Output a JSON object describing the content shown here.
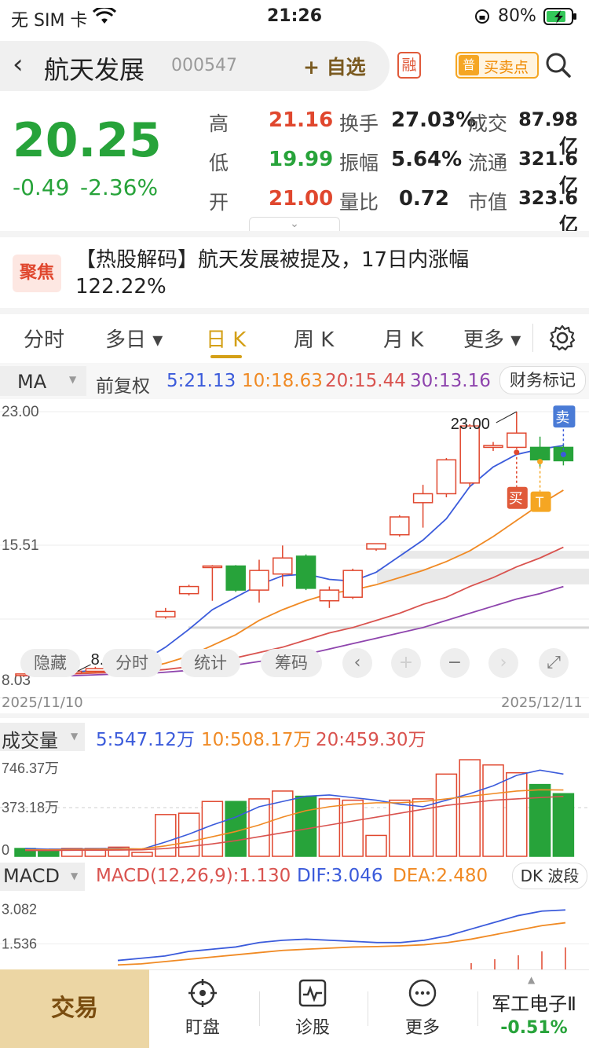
{
  "status": {
    "carrier": "无 SIM 卡",
    "time": "21:26",
    "battery": "80%"
  },
  "header": {
    "stock_name": "航天发展",
    "stock_code": "000547",
    "watch_label": "+ 自选",
    "margin_label": "融",
    "bs_points_badge": "普",
    "bs_points_label": "买卖点"
  },
  "quote": {
    "price": "20.25",
    "change": "-0.49",
    "change_pct": "-2.36%",
    "rows": [
      {
        "l1": "高",
        "v1": "21.16",
        "l2": "换手",
        "v2": "27.03%",
        "l3": "成交",
        "v3": "87.98亿"
      },
      {
        "l1": "低",
        "v1": "19.99",
        "l2": "振幅",
        "v2": "5.64%",
        "l3": "流通",
        "v3": "321.6亿"
      },
      {
        "l1": "开",
        "v1": "21.00",
        "l2": "量比",
        "v2": "0.72",
        "l3": "市值",
        "v3": "323.6亿"
      }
    ],
    "colors": {
      "up": "#e0472e",
      "down": "#27a33a",
      "neutral": "#222222"
    }
  },
  "news": {
    "badge": "聚焦",
    "text": "【热股解码】航天发展被提及，17日内涨幅122.22%"
  },
  "tabs": [
    {
      "label": "分时"
    },
    {
      "label": "多日 ▾"
    },
    {
      "label": "日 K"
    },
    {
      "label": "周 K"
    },
    {
      "label": "月 K"
    },
    {
      "label": "更多 ▾"
    }
  ],
  "active_tab": "日 K",
  "ma_bar": {
    "selector": "MA",
    "adjust": "前复权",
    "ma5": "5:21.13",
    "ma10": "10:18.63",
    "ma20": "20:15.44",
    "ma30": "30:13.16",
    "finance_btn": "财务标记"
  },
  "chart_controls": [
    "隐藏",
    "分时",
    "统计",
    "筹码",
    "‹",
    "+",
    "−",
    "›",
    "⤢"
  ],
  "chart_data": [
    {
      "type": "candlestick",
      "title": "",
      "x_start": "2025/11/10",
      "x_end": "2025/12/11",
      "y_ticks": [
        "23.00",
        "15.51",
        "8.03"
      ],
      "ylim": [
        8.03,
        23.0
      ],
      "high_label": "23.00",
      "low_label": "8.26",
      "candles": [
        {
          "o": 8.26,
          "c": 8.3,
          "h": 8.35,
          "l": 8.26
        },
        {
          "o": 8.3,
          "c": 8.35,
          "h": 8.4,
          "l": 8.28
        },
        {
          "o": 8.35,
          "c": 8.45,
          "h": 8.5,
          "l": 8.3
        },
        {
          "o": 8.45,
          "c": 8.6,
          "h": 8.7,
          "l": 8.4
        },
        {
          "o": 8.6,
          "c": 9.2,
          "h": 9.3,
          "l": 8.55
        },
        {
          "o": 9.3,
          "c": 9.45,
          "h": 9.5,
          "l": 9.25
        },
        {
          "o": 11.5,
          "c": 11.8,
          "h": 12.0,
          "l": 11.4
        },
        {
          "o": 12.8,
          "c": 13.2,
          "h": 13.3,
          "l": 12.7
        },
        {
          "o": 14.3,
          "c": 14.35,
          "h": 14.4,
          "l": 12.4
        },
        {
          "o": 14.35,
          "c": 13.0,
          "h": 14.4,
          "l": 12.9
        },
        {
          "o": 13.0,
          "c": 14.1,
          "h": 14.7,
          "l": 12.3
        },
        {
          "o": 13.9,
          "c": 14.8,
          "h": 15.5,
          "l": 13.2
        },
        {
          "o": 14.9,
          "c": 13.1,
          "h": 15.0,
          "l": 13.0
        },
        {
          "o": 12.4,
          "c": 13.0,
          "h": 13.2,
          "l": 12.0
        },
        {
          "o": 12.6,
          "c": 14.1,
          "h": 14.2,
          "l": 12.5
        },
        {
          "o": 15.3,
          "c": 15.6,
          "h": 15.6,
          "l": 15.2
        },
        {
          "o": 16.1,
          "c": 17.1,
          "h": 17.2,
          "l": 16.0
        },
        {
          "o": 17.9,
          "c": 18.4,
          "h": 18.9,
          "l": 16.5
        },
        {
          "o": 18.4,
          "c": 20.3,
          "h": 20.4,
          "l": 18.2
        },
        {
          "o": 19.0,
          "c": 22.2,
          "h": 22.3,
          "l": 18.8
        },
        {
          "o": 21.0,
          "c": 21.1,
          "h": 21.3,
          "l": 20.8
        },
        {
          "o": 21.0,
          "c": 21.8,
          "h": 23.0,
          "l": 20.9
        },
        {
          "o": 21.0,
          "c": 20.3,
          "h": 21.6,
          "l": 19.9
        },
        {
          "o": 21.0,
          "c": 20.25,
          "h": 21.16,
          "l": 19.99
        }
      ],
      "series": [
        {
          "name": "MA5",
          "color": "#3b5bdb",
          "values": [
            8.3,
            8.35,
            8.4,
            8.5,
            8.7,
            9.0,
            9.8,
            10.8,
            11.9,
            12.6,
            13.3,
            13.8,
            13.9,
            13.6,
            13.5,
            14.0,
            14.9,
            15.8,
            17.0,
            18.8,
            19.9,
            20.6,
            20.9,
            21.1
          ]
        },
        {
          "name": "MA10",
          "color": "#f08a24",
          "values": [
            8.3,
            8.3,
            8.35,
            8.4,
            8.5,
            8.6,
            8.9,
            9.3,
            9.9,
            10.5,
            11.3,
            11.9,
            12.4,
            12.8,
            13.0,
            13.3,
            13.7,
            14.1,
            14.6,
            15.2,
            16.0,
            16.9,
            17.8,
            18.6
          ]
        },
        {
          "name": "MA20",
          "color": "#d9534f",
          "values": [
            8.3,
            8.3,
            8.3,
            8.35,
            8.4,
            8.45,
            8.55,
            8.7,
            8.9,
            9.2,
            9.5,
            9.8,
            10.2,
            10.6,
            10.9,
            11.3,
            11.7,
            12.2,
            12.6,
            13.2,
            13.7,
            14.3,
            14.8,
            15.4
          ]
        },
        {
          "name": "MA30",
          "color": "#8e44ad",
          "values": [
            8.2,
            8.2,
            8.2,
            8.25,
            8.3,
            8.3,
            8.4,
            8.5,
            8.6,
            8.8,
            9.0,
            9.2,
            9.4,
            9.7,
            10.0,
            10.3,
            10.6,
            10.9,
            11.3,
            11.7,
            12.1,
            12.5,
            12.8,
            13.2
          ]
        }
      ],
      "markers": {
        "buy": "买",
        "sell": "卖",
        "t": "T"
      }
    },
    {
      "type": "bar",
      "title": "成交量",
      "ma5": "5:547.12万",
      "ma10": "10:508.17万",
      "ma20": "20:459.30万",
      "y_ticks": [
        "746.37万",
        "373.18万",
        "0"
      ],
      "ylim": [
        0,
        746.37
      ],
      "values": [
        60,
        50,
        60,
        60,
        70,
        30,
        320,
        330,
        420,
        420,
        440,
        500,
        460,
        440,
        430,
        160,
        430,
        440,
        630,
        740,
        700,
        640,
        550,
        480
      ],
      "directions": [
        "d",
        "d",
        "u",
        "u",
        "u",
        "u",
        "u",
        "u",
        "u",
        "d",
        "u",
        "u",
        "d",
        "u",
        "u",
        "u",
        "u",
        "u",
        "u",
        "u",
        "u",
        "u",
        "d",
        "d"
      ],
      "series": [
        {
          "name": "MA5",
          "color": "#3b5bdb",
          "values": [
            60,
            55,
            55,
            58,
            60,
            55,
            110,
            170,
            240,
            300,
            380,
            420,
            460,
            470,
            450,
            430,
            400,
            380,
            430,
            480,
            540,
            620,
            660,
            630
          ]
        },
        {
          "name": "MA10",
          "color": "#f08a24",
          "values": [
            50,
            50,
            52,
            54,
            56,
            58,
            80,
            110,
            150,
            190,
            240,
            300,
            350,
            380,
            400,
            410,
            410,
            420,
            440,
            460,
            480,
            500,
            510,
            508
          ]
        },
        {
          "name": "MA20",
          "color": "#d9534f",
          "values": [
            45,
            45,
            46,
            47,
            48,
            50,
            60,
            75,
            95,
            120,
            150,
            180,
            210,
            240,
            270,
            300,
            330,
            360,
            390,
            410,
            430,
            440,
            450,
            459
          ]
        }
      ]
    },
    {
      "type": "line",
      "title": "MACD",
      "params": "MACD(12,26,9):1.130",
      "dif": "DIF:3.046",
      "dea": "DEA:2.480",
      "y_ticks": [
        "3.082",
        "1.536"
      ],
      "series": [
        {
          "name": "DIF",
          "color": "#3b5bdb",
          "values": [
            0.8,
            0.9,
            1.0,
            1.2,
            1.3,
            1.4,
            1.6,
            1.7,
            1.75,
            1.7,
            1.65,
            1.6,
            1.6,
            1.7,
            1.9,
            2.2,
            2.5,
            2.8,
            3.0,
            3.05
          ]
        },
        {
          "name": "DEA",
          "color": "#f08a24",
          "values": [
            0.6,
            0.65,
            0.75,
            0.85,
            0.95,
            1.05,
            1.15,
            1.25,
            1.3,
            1.35,
            1.4,
            1.42,
            1.45,
            1.5,
            1.6,
            1.75,
            1.95,
            2.15,
            2.35,
            2.48
          ]
        }
      ]
    }
  ],
  "macd_bar": {
    "selector": "MACD",
    "dk_btn": "DK 波段"
  },
  "volume_bar": {
    "selector": "成交量"
  },
  "bottom_nav": {
    "trade": "交易",
    "items": [
      {
        "label": "盯盘"
      },
      {
        "label": "诊股"
      },
      {
        "label": "更多"
      }
    ],
    "sector_name": "军工电子Ⅱ",
    "sector_change": "-0.51%"
  }
}
